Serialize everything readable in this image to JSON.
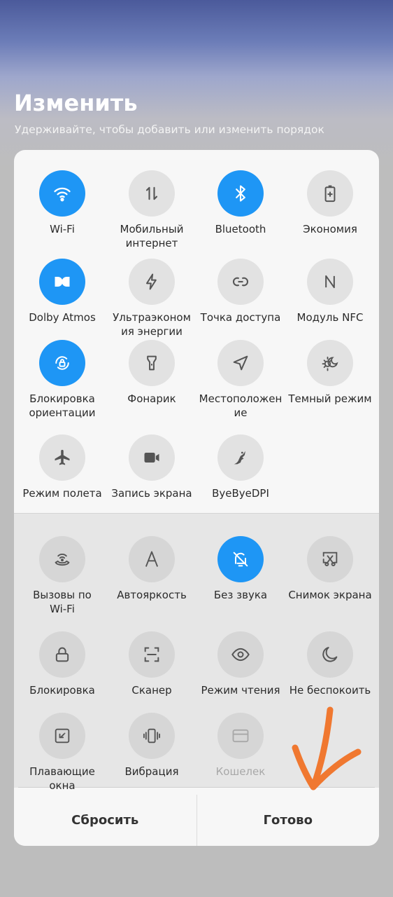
{
  "header": {
    "title": "Изменить",
    "subtitle": "Удерживайте, чтобы добавить или изменить порядок"
  },
  "active_tiles": [
    {
      "label": "Wi-Fi",
      "icon": "wifi-icon",
      "on": true
    },
    {
      "label": "Мобильный\nинтернет",
      "icon": "mobile-data-icon",
      "on": false
    },
    {
      "label": "Bluetooth",
      "icon": "bluetooth-icon",
      "on": true
    },
    {
      "label": "Экономия",
      "icon": "battery-saver-icon",
      "on": false
    },
    {
      "label": "Dolby Atmos",
      "icon": "dolby-icon",
      "on": true
    },
    {
      "label": "Ультраэконом\nия энергии",
      "icon": "ultra-saver-icon",
      "on": false
    },
    {
      "label": "Точка доступа",
      "icon": "hotspot-icon",
      "on": false
    },
    {
      "label": "Модуль NFC",
      "icon": "nfc-icon",
      "on": false
    },
    {
      "label": "Блокировка\nориентации",
      "icon": "rotation-lock-icon",
      "on": true
    },
    {
      "label": "Фонарик",
      "icon": "flashlight-icon",
      "on": false
    },
    {
      "label": "Местоположен\nие",
      "icon": "location-icon",
      "on": false
    },
    {
      "label": "Темный режим",
      "icon": "dark-mode-icon",
      "on": false
    },
    {
      "label": "Режим полета",
      "icon": "airplane-icon",
      "on": false
    },
    {
      "label": "Запись экрана",
      "icon": "screen-record-icon",
      "on": false
    },
    {
      "label": "ByeByeDPI",
      "icon": "byebyedpi-icon",
      "on": false
    }
  ],
  "inactive_tiles": [
    {
      "label": "Вызовы по\nWi-Fi",
      "icon": "wifi-calling-icon",
      "on": false
    },
    {
      "label": "Автояркость",
      "icon": "auto-brightness-icon",
      "on": false
    },
    {
      "label": "Без звука",
      "icon": "silent-icon",
      "on": true
    },
    {
      "label": "Снимок экрана",
      "icon": "screenshot-icon",
      "on": false
    },
    {
      "label": "Блокировка",
      "icon": "lock-icon",
      "on": false
    },
    {
      "label": "Сканер",
      "icon": "scanner-icon",
      "on": false
    },
    {
      "label": "Режим чтения",
      "icon": "reading-mode-icon",
      "on": false
    },
    {
      "label": "Не беспокоить",
      "icon": "do-not-disturb-icon",
      "on": false
    },
    {
      "label": "Плавающие\nокна",
      "icon": "floating-windows-icon",
      "on": false
    },
    {
      "label": "Вибрация",
      "icon": "vibration-icon",
      "on": false
    },
    {
      "label": "Кошелек",
      "icon": "wallet-icon",
      "on": false,
      "disabled": true
    }
  ],
  "footer": {
    "reset_label": "Сбросить",
    "done_label": "Готово"
  },
  "colors": {
    "accent": "#1e96f5",
    "annotation_arrow": "#f07830"
  }
}
